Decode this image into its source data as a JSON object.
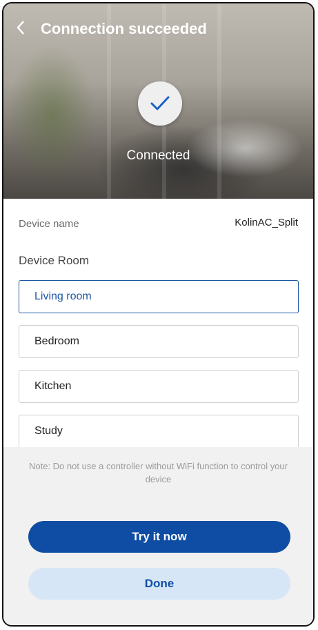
{
  "header": {
    "back_icon": "chevron-left-icon",
    "title": "Connection succeeded"
  },
  "status": {
    "icon": "check-icon",
    "text": "Connected"
  },
  "device": {
    "name_label": "Device name",
    "name_value": "KolinAC_Split"
  },
  "rooms": {
    "label": "Device Room",
    "items": [
      {
        "label": "Living room",
        "selected": true
      },
      {
        "label": "Bedroom",
        "selected": false
      },
      {
        "label": "Kitchen",
        "selected": false
      },
      {
        "label": "Study",
        "selected": false
      }
    ]
  },
  "note": "Note: Do not use a controller without WiFi function to control your device",
  "actions": {
    "try_label": "Try it now",
    "done_label": "Done"
  },
  "colors": {
    "accent": "#0e4da3",
    "secondary_button": "#d6e6f6",
    "footer_bg": "#f1f1f1"
  }
}
